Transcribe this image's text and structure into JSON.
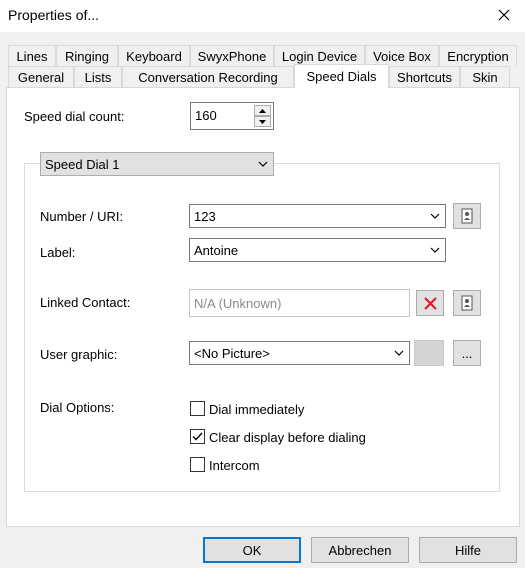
{
  "window": {
    "title": "Properties of..."
  },
  "tabs": {
    "row1": [
      "Lines",
      "Ringing",
      "Keyboard",
      "SwyxPhone",
      "Login Device",
      "Voice Box",
      "Encryption"
    ],
    "row2": [
      "General",
      "Lists",
      "Conversation Recording",
      "Speed Dials",
      "Shortcuts",
      "Skin"
    ],
    "active": "Speed Dials"
  },
  "speed_dial_count": {
    "label": "Speed dial count:",
    "value": "160"
  },
  "speed_dial_selector": {
    "value": "Speed Dial 1"
  },
  "number": {
    "label": "Number / URI:",
    "value": "123"
  },
  "label_field": {
    "label": "Label:",
    "value": "Antoine"
  },
  "linked_contact": {
    "label": "Linked Contact:",
    "value": "N/A (Unknown)"
  },
  "user_graphic": {
    "label": "User graphic:",
    "value": "<No Picture>",
    "browse_label": "..."
  },
  "dial_options": {
    "label": "Dial Options:",
    "items": [
      {
        "label": "Dial immediately",
        "checked": false
      },
      {
        "label": "Clear display before dialing",
        "checked": true
      },
      {
        "label": "Intercom",
        "checked": false
      }
    ]
  },
  "buttons": {
    "ok": "OK",
    "cancel": "Abbrechen",
    "help": "Hilfe"
  },
  "colors": {
    "accent": "#0078d7",
    "delete_red": "#e81123"
  },
  "icons": [
    "close-icon",
    "spin-up-icon",
    "spin-down-icon",
    "chevron-down-icon",
    "address-book-icon",
    "delete-x-icon",
    "check-icon"
  ]
}
